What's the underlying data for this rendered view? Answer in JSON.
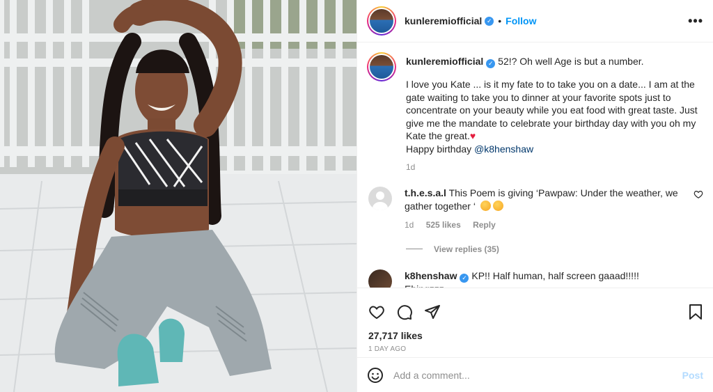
{
  "header": {
    "username": "kunleremiofficial",
    "separator": "•",
    "follow_label": "Follow",
    "more_label": "•••"
  },
  "caption": {
    "username": "kunleremiofficial",
    "line1": "52!? Oh well Age is but a number.",
    "body": "I love you Kate ... is it my fate to to take you on a date... I am at the gate waiting to take you to dinner at your favorite spots just to concentrate on your beauty while you eat food with great taste. Just give me the mandate to celebrate your birthday day with you oh my Kate the great.",
    "heart": "♥",
    "happy": "Happy birthday ",
    "mention": "@k8henshaw",
    "age": "1d"
  },
  "comment1": {
    "username": "t.h.e.s.a.l",
    "text": "This Poem is giving ‘Pawpaw: Under the weather, we gather together ‘",
    "age": "1d",
    "likes": "525 likes",
    "reply": "Reply",
    "view_replies": "View replies (35)"
  },
  "comment2": {
    "username": "k8henshaw",
    "text": "KP!! Half human, half screen gaaad!!!!! Ebingzzz"
  },
  "footer": {
    "likes": "27,717 likes",
    "time": "1 DAY AGO",
    "comment_placeholder": "Add a comment...",
    "post_label": "Post"
  },
  "colors": {
    "accent": "#0095f6",
    "verified": "#3897f0",
    "post_disabled": "#b3dbff"
  },
  "icons": {
    "like": "heart-icon",
    "comment": "comment-icon",
    "share": "paper-plane-icon",
    "save": "bookmark-icon",
    "emoji": "smiley-icon"
  }
}
